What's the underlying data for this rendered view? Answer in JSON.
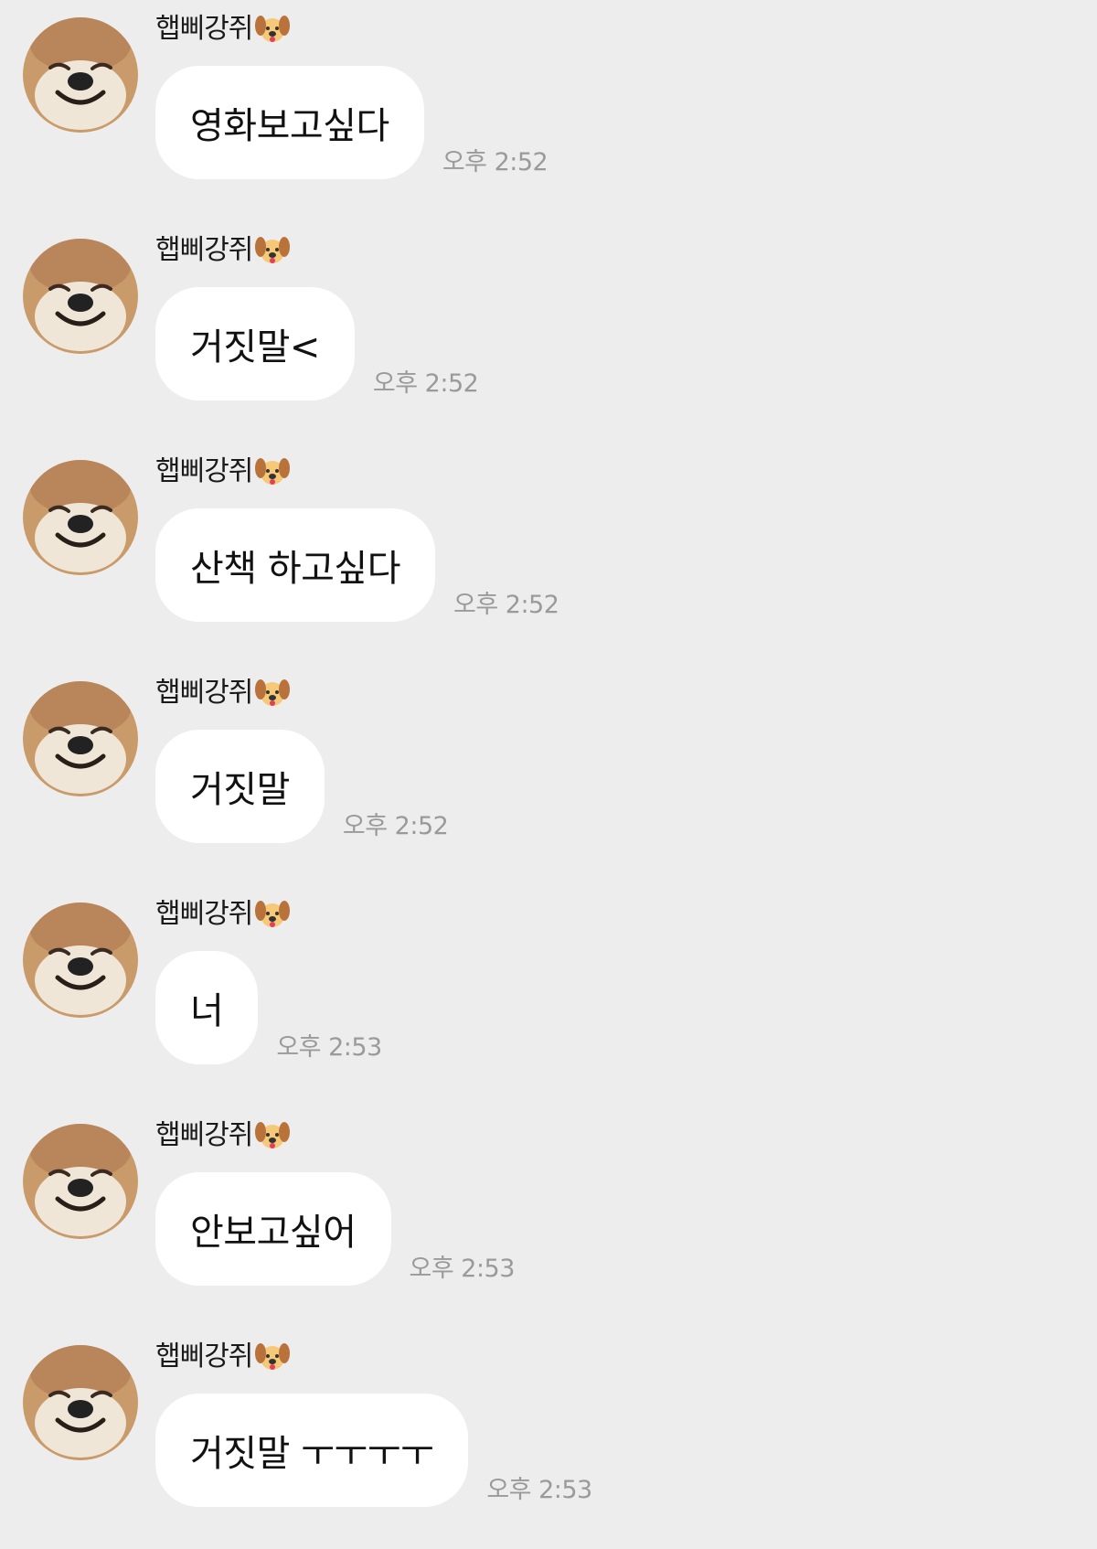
{
  "chat": {
    "sender_name": "햅삐강쥐",
    "sender_emoji_icon": "dog-face-icon",
    "avatar_icon": "shiba-dog-avatar",
    "messages": [
      {
        "text": "영화보고싶다",
        "time": "오후 2:52"
      },
      {
        "text": " 거짓말<",
        "time": "오후 2:52"
      },
      {
        "text": "산책 하고싶다",
        "time": "오후 2:52"
      },
      {
        "text": "거짓말",
        "time": "오후 2:52"
      },
      {
        "text": "너",
        "time": "오후 2:53"
      },
      {
        "text": "안보고싶어",
        "time": "오후 2:53"
      },
      {
        "text": "거짓말 ㅜㅜㅜㅜ",
        "time": "오후 2:53"
      }
    ]
  },
  "colors": {
    "background": "#ededed",
    "bubble": "#ffffff",
    "time_text": "#9a9a9a"
  }
}
